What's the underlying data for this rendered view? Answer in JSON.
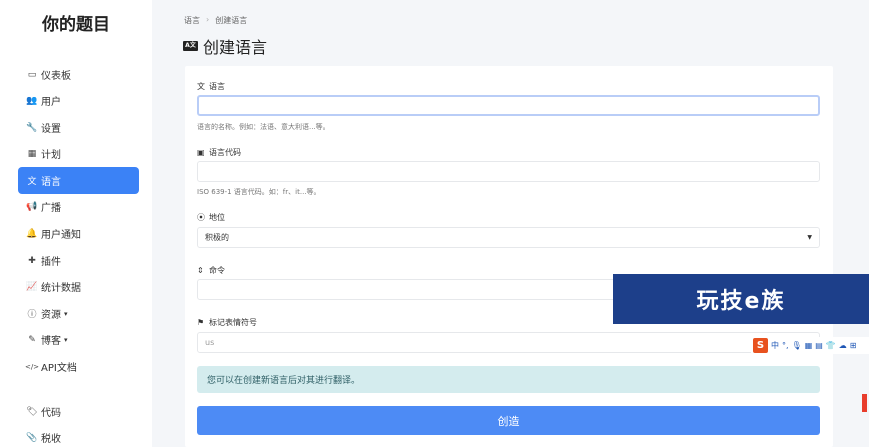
{
  "brand": "你的题目",
  "sidebar": {
    "items": [
      {
        "label": "仪表板",
        "icon": "monitor-icon",
        "glyph": "▭",
        "active": false,
        "caret": ""
      },
      {
        "label": "用户",
        "icon": "users-icon",
        "glyph": "👥",
        "active": false,
        "caret": ""
      },
      {
        "label": "设置",
        "icon": "wrench-icon",
        "glyph": "🔧",
        "active": false,
        "caret": ""
      },
      {
        "label": "计划",
        "icon": "calendar-icon",
        "glyph": "▦",
        "active": false,
        "caret": ""
      },
      {
        "label": "语言",
        "icon": "language-icon",
        "glyph": "文",
        "active": true,
        "caret": ""
      },
      {
        "label": "广播",
        "icon": "broadcast-icon",
        "glyph": "📢",
        "active": false,
        "caret": ""
      },
      {
        "label": "用户通知",
        "icon": "bell-icon",
        "glyph": "🔔",
        "active": false,
        "caret": ""
      },
      {
        "label": "插件",
        "icon": "puzzle-icon",
        "glyph": "✚",
        "active": false,
        "caret": ""
      },
      {
        "label": "统计数据",
        "icon": "chart-icon",
        "glyph": "📈",
        "active": false,
        "caret": ""
      },
      {
        "label": "资源",
        "icon": "info-icon",
        "glyph": "ⓘ",
        "active": false,
        "caret": "▾"
      },
      {
        "label": "博客",
        "icon": "blog-icon",
        "glyph": "✎",
        "active": false,
        "caret": "▾"
      },
      {
        "label": "API文档",
        "icon": "code-icon",
        "glyph": "</>",
        "active": false,
        "caret": ""
      },
      {
        "label": "代码",
        "icon": "tag-icon",
        "glyph": "🏷",
        "active": false,
        "caret": ""
      },
      {
        "label": "税收",
        "icon": "paperclip-icon",
        "glyph": "📎",
        "active": false,
        "caret": ""
      }
    ]
  },
  "breadcrumb": {
    "parent": "语言",
    "separator": "›",
    "current": "创建语言"
  },
  "page_title": "创建语言",
  "page_title_icon_text": "A文",
  "form": {
    "name": {
      "label": "语言",
      "icon_glyph": "文",
      "value": "",
      "help": "语言的名称。例如：法语、意大利语...等。"
    },
    "code": {
      "label": "语言代码",
      "icon_glyph": "▣",
      "value": "",
      "help": "ISO 639-1 语言代码。如：fr、it...等。"
    },
    "status": {
      "label": "地位",
      "icon_glyph": "⦿",
      "value": "积极的"
    },
    "order": {
      "label": "命令",
      "icon_glyph": "⇕",
      "value": ""
    },
    "flag": {
      "label": "标记表情符号",
      "icon_glyph": "⚑",
      "placeholder": "us"
    }
  },
  "alert": "您可以在创建新语言后对其进行翻译。",
  "submit_label": "创造",
  "watermark": "玩技e族",
  "ime": {
    "logo": "S",
    "mode": "中"
  }
}
